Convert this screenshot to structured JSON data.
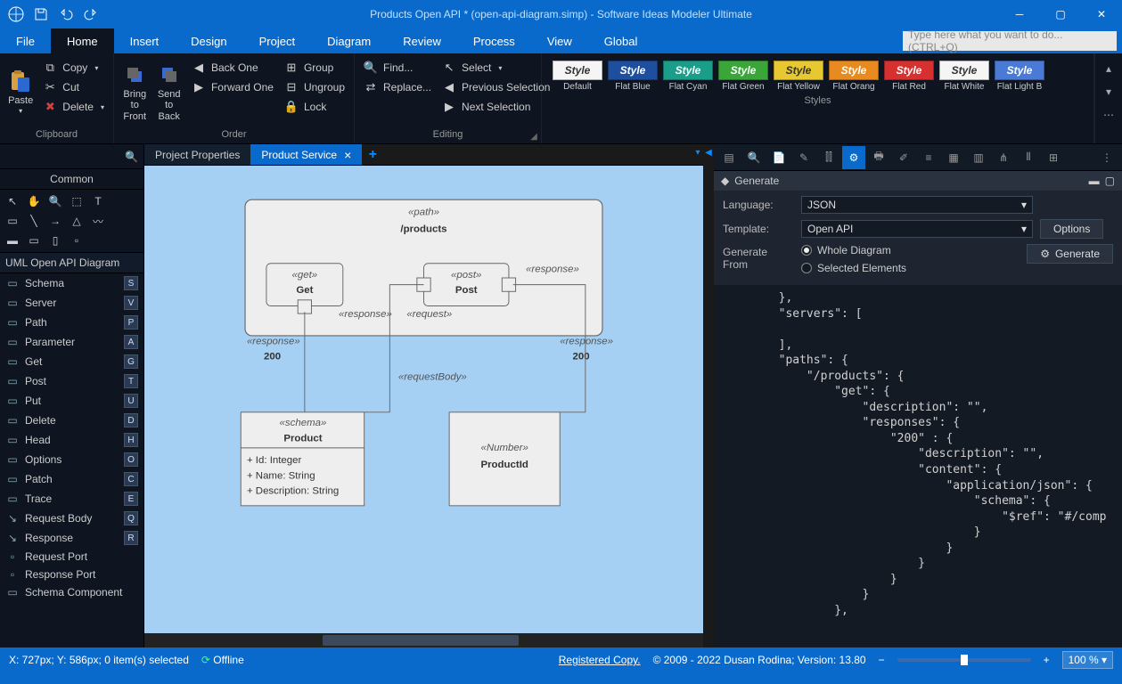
{
  "title": "Products Open API * (open-api-diagram.simp) - Software Ideas Modeler Ultimate",
  "menu": {
    "file": "File",
    "tabs": [
      "Home",
      "Insert",
      "Design",
      "Project",
      "Diagram",
      "Review",
      "Process",
      "View",
      "Global"
    ],
    "searchPH": "Type here what you want to do...  (CTRL+Q)"
  },
  "ribbon": {
    "clipboard": {
      "paste": "Paste",
      "copy": "Copy",
      "cut": "Cut",
      "delete": "Delete",
      "label": "Clipboard"
    },
    "order": {
      "bringFront": "Bring to Front",
      "sendBack": "Send to Back",
      "backOne": "Back One",
      "forwardOne": "Forward One",
      "group": "Group",
      "ungroup": "Ungroup",
      "lock": "Lock",
      "label": "Order"
    },
    "editing": {
      "find": "Find...",
      "replace": "Replace...",
      "select": "Select",
      "prevSel": "Previous Selection",
      "nextSel": "Next Selection",
      "label": "Editing"
    },
    "styles": {
      "label": "Styles",
      "items": [
        {
          "text": "Style",
          "bg": "#f5f5f5",
          "fg": "#333",
          "lbl": "Default"
        },
        {
          "text": "Style",
          "bg": "#1e4f9e",
          "fg": "#fff",
          "lbl": "Flat Blue"
        },
        {
          "text": "Style",
          "bg": "#1a9e8a",
          "fg": "#fff",
          "lbl": "Flat Cyan"
        },
        {
          "text": "Style",
          "bg": "#3aa63a",
          "fg": "#fff",
          "lbl": "Flat Green"
        },
        {
          "text": "Style",
          "bg": "#e8c830",
          "fg": "#333",
          "lbl": "Flat Yellow"
        },
        {
          "text": "Style",
          "bg": "#e88a20",
          "fg": "#fff",
          "lbl": "Flat Orang"
        },
        {
          "text": "Style",
          "bg": "#d63030",
          "fg": "#fff",
          "lbl": "Flat Red"
        },
        {
          "text": "Style",
          "bg": "#f5f5f5",
          "fg": "#333",
          "lbl": "Flat White"
        },
        {
          "text": "Style",
          "bg": "#4a7ad6",
          "fg": "#fff",
          "lbl": "Flat Light B"
        }
      ]
    }
  },
  "leftPanel": {
    "tab": "Common",
    "category": "UML Open API Diagram",
    "tools": [
      {
        "label": "Schema",
        "key": "S",
        "icon": "▭"
      },
      {
        "label": "Server",
        "key": "V",
        "icon": "▭"
      },
      {
        "label": "Path",
        "key": "P",
        "icon": "▭"
      },
      {
        "label": "Parameter",
        "key": "A",
        "icon": "▭"
      },
      {
        "label": "Get",
        "key": "G",
        "icon": "▭"
      },
      {
        "label": "Post",
        "key": "T",
        "icon": "▭"
      },
      {
        "label": "Put",
        "key": "U",
        "icon": "▭"
      },
      {
        "label": "Delete",
        "key": "D",
        "icon": "▭"
      },
      {
        "label": "Head",
        "key": "H",
        "icon": "▭"
      },
      {
        "label": "Options",
        "key": "O",
        "icon": "▭"
      },
      {
        "label": "Patch",
        "key": "C",
        "icon": "▭"
      },
      {
        "label": "Trace",
        "key": "E",
        "icon": "▭"
      },
      {
        "label": "Request Body",
        "key": "Q",
        "icon": "↘"
      },
      {
        "label": "Response",
        "key": "R",
        "icon": "↘"
      },
      {
        "label": "Request Port",
        "key": "",
        "icon": "▫"
      },
      {
        "label": "Response Port",
        "key": "",
        "icon": "▫"
      },
      {
        "label": "Schema Component",
        "key": "",
        "icon": "▭"
      }
    ]
  },
  "docTabs": [
    {
      "label": "Project Properties",
      "active": false
    },
    {
      "label": "Product Service",
      "active": true
    }
  ],
  "diagram": {
    "path": {
      "stereo": "«path»",
      "name": "/products"
    },
    "get": {
      "stereo": "«get»",
      "name": "Get",
      "respLabel": "«response»",
      "resp200label": "«response»",
      "resp200": "200"
    },
    "post": {
      "stereo": "«post»",
      "name": "Post",
      "reqLabel": "«request»",
      "respLabel": "«response»",
      "resp200label": "«response»",
      "resp200": "200"
    },
    "reqBody": "«requestBody»",
    "product": {
      "stereo": "«schema»",
      "name": "Product",
      "attrs": [
        "+ Id: Integer",
        "+ Name: String",
        "+ Description: String"
      ]
    },
    "productId": {
      "stereo": "«Number»",
      "name": "ProductId"
    }
  },
  "rightPanel": {
    "title": "Generate",
    "langLbl": "Language:",
    "lang": "JSON",
    "tmplLbl": "Template:",
    "tmpl": "Open API",
    "genFromLbl": "Generate From",
    "whole": "Whole Diagram",
    "selected": "Selected Elements",
    "optionsBtn": "Options",
    "generateBtn": "Generate",
    "code": "        },\n        \"servers\": [\n\n        ],\n        \"paths\": {\n            \"/products\": {\n                \"get\": {\n                    \"description\": \"\",\n                    \"responses\": {\n                        \"200\" : {\n                            \"description\": \"\",\n                            \"content\": {\n                                \"application/json\": {\n                                    \"schema\": {\n                                        \"$ref\": \"#/comp\n                                    }\n                                }\n                            }\n                        }\n                    }\n                },"
  },
  "status": {
    "pos": "X: 727px; Y: 586px; 0 item(s) selected",
    "offline": "Offline",
    "reg": "Registered Copy.",
    "copyright": "© 2009 - 2022 Dusan Rodina; Version: 13.80",
    "zoom": "100 %"
  }
}
